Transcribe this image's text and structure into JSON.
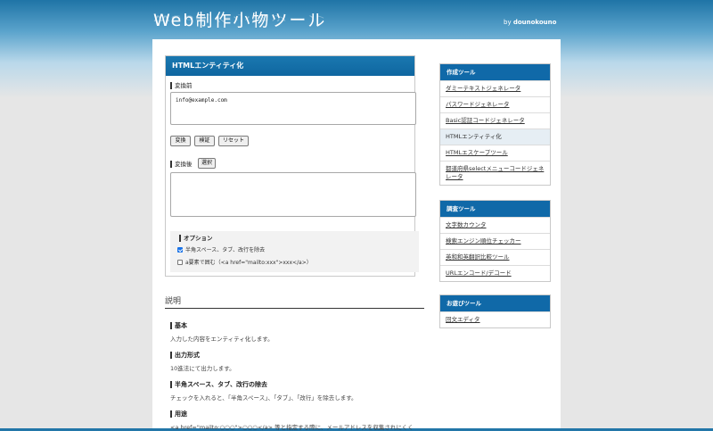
{
  "header": {
    "title": "Web制作小物ツール",
    "by_prefix": "by ",
    "author": "dounokouno"
  },
  "tool": {
    "heading": "HTMLエンティティ化",
    "before_label": "変換前",
    "input_value": "info@example.com",
    "buttons": {
      "convert": "変換",
      "verify": "検証",
      "reset": "リセット"
    },
    "after_label": "変換後",
    "select_label": "選択",
    "output_value": "",
    "options": {
      "title": "オプション",
      "opt1": "半角スペース、タブ、改行を除去",
      "opt2": "a要素で囲む（<a href=\"mailto:xxx\">xxx</a>）"
    }
  },
  "explanation": {
    "title": "説明",
    "sections": [
      {
        "heading": "基本",
        "text": "入力した内容をエンティティ化します。"
      },
      {
        "heading": "出力形式",
        "text": "10進法にて出力します。"
      },
      {
        "heading": "半角スペース、タブ、改行の除去",
        "text": "チェックを入れると、「半角スペース」、「タブ」、「改行」を除去します。"
      },
      {
        "heading": "用途",
        "text": "<a href=\"mailto:○○○\">○○○</a> 等と指定する際に、メールアドレスを収集されにくく"
      }
    ]
  },
  "sidebar": {
    "groups": [
      {
        "title": "作成ツール",
        "items": [
          "ダミーテキストジェネレータ",
          "パスワードジェネレータ",
          "Basic認証コードジェネレータ",
          "HTMLエンティティ化",
          "HTMLエスケープツール",
          "都道府県selectメニューコードジェネレータ"
        ]
      },
      {
        "title": "調査ツール",
        "items": [
          "文字数カウンタ",
          "検索エンジン順位チェッカー",
          "英和和英翻訳比較ツール",
          "URLエンコード/デコード"
        ]
      },
      {
        "title": "お遊びツール",
        "items": [
          "回文エディタ"
        ]
      }
    ]
  }
}
